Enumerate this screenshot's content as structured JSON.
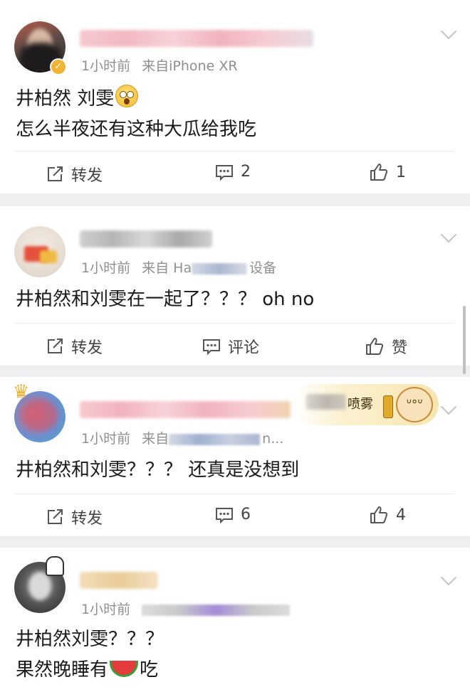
{
  "posts": [
    {
      "time": "1小时前",
      "source": "来自iPhone XR",
      "lines": [
        "井柏然 刘雯",
        "怎么半夜还有这种大瓜给我吃"
      ],
      "emoji": "shocked-face-emoji",
      "actions": {
        "repost": "转发",
        "comment": "2",
        "like": "1"
      }
    },
    {
      "time": "1小时前",
      "source_prefix": "来自 Ha",
      "source_suffix": "设备",
      "lines": [
        "井柏然和刘雯在一起了？？？ oh no"
      ],
      "actions": {
        "repost": "转发",
        "comment": "评论",
        "like": "赞"
      }
    },
    {
      "time": "1小时前",
      "source_prefix": "来自",
      "source_suffix": "n...",
      "badge_text": "喷雾",
      "lines": [
        "井柏然和刘雯？？？ 还真是没想到"
      ],
      "actions": {
        "repost": "转发",
        "comment": "6",
        "like": "4"
      }
    },
    {
      "time": "1小时前",
      "lines": [
        "井柏然刘雯？？？"
      ],
      "line2_before": "果然晚睡有",
      "line2_after": "吃",
      "emoji": "watermelon-emoji"
    }
  ],
  "colors": {
    "accent_badge": "#f2b233",
    "card": "#ffffff",
    "background": "#efeff1"
  }
}
